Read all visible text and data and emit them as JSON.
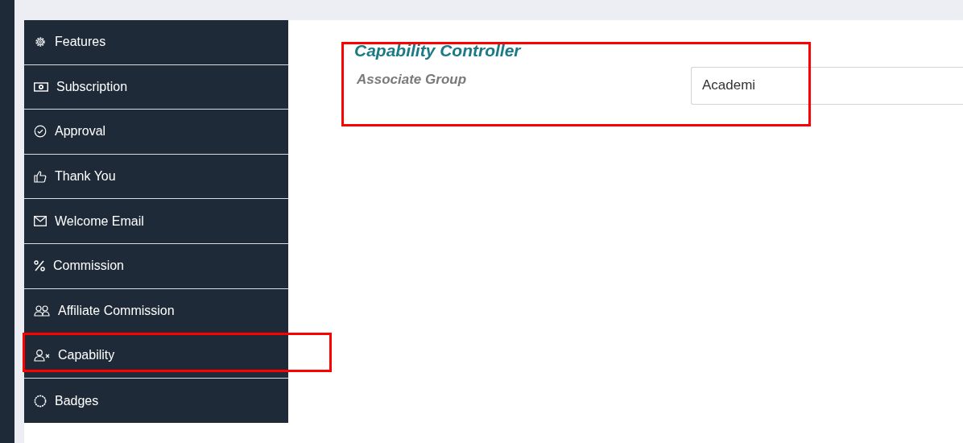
{
  "sidebar": {
    "items": [
      {
        "label": "Features",
        "highlighted": false
      },
      {
        "label": "Subscription",
        "highlighted": false
      },
      {
        "label": "Approval",
        "highlighted": false
      },
      {
        "label": "Thank You",
        "highlighted": false
      },
      {
        "label": "Welcome Email",
        "highlighted": false
      },
      {
        "label": "Commission",
        "highlighted": false
      },
      {
        "label": "Affiliate Commission",
        "highlighted": false
      },
      {
        "label": "Capability",
        "highlighted": true
      },
      {
        "label": "Badges",
        "highlighted": false
      }
    ]
  },
  "panel": {
    "title": "Capability Controller",
    "highlighted": true,
    "field": {
      "label": "Associate Group",
      "value": "Academi"
    }
  }
}
